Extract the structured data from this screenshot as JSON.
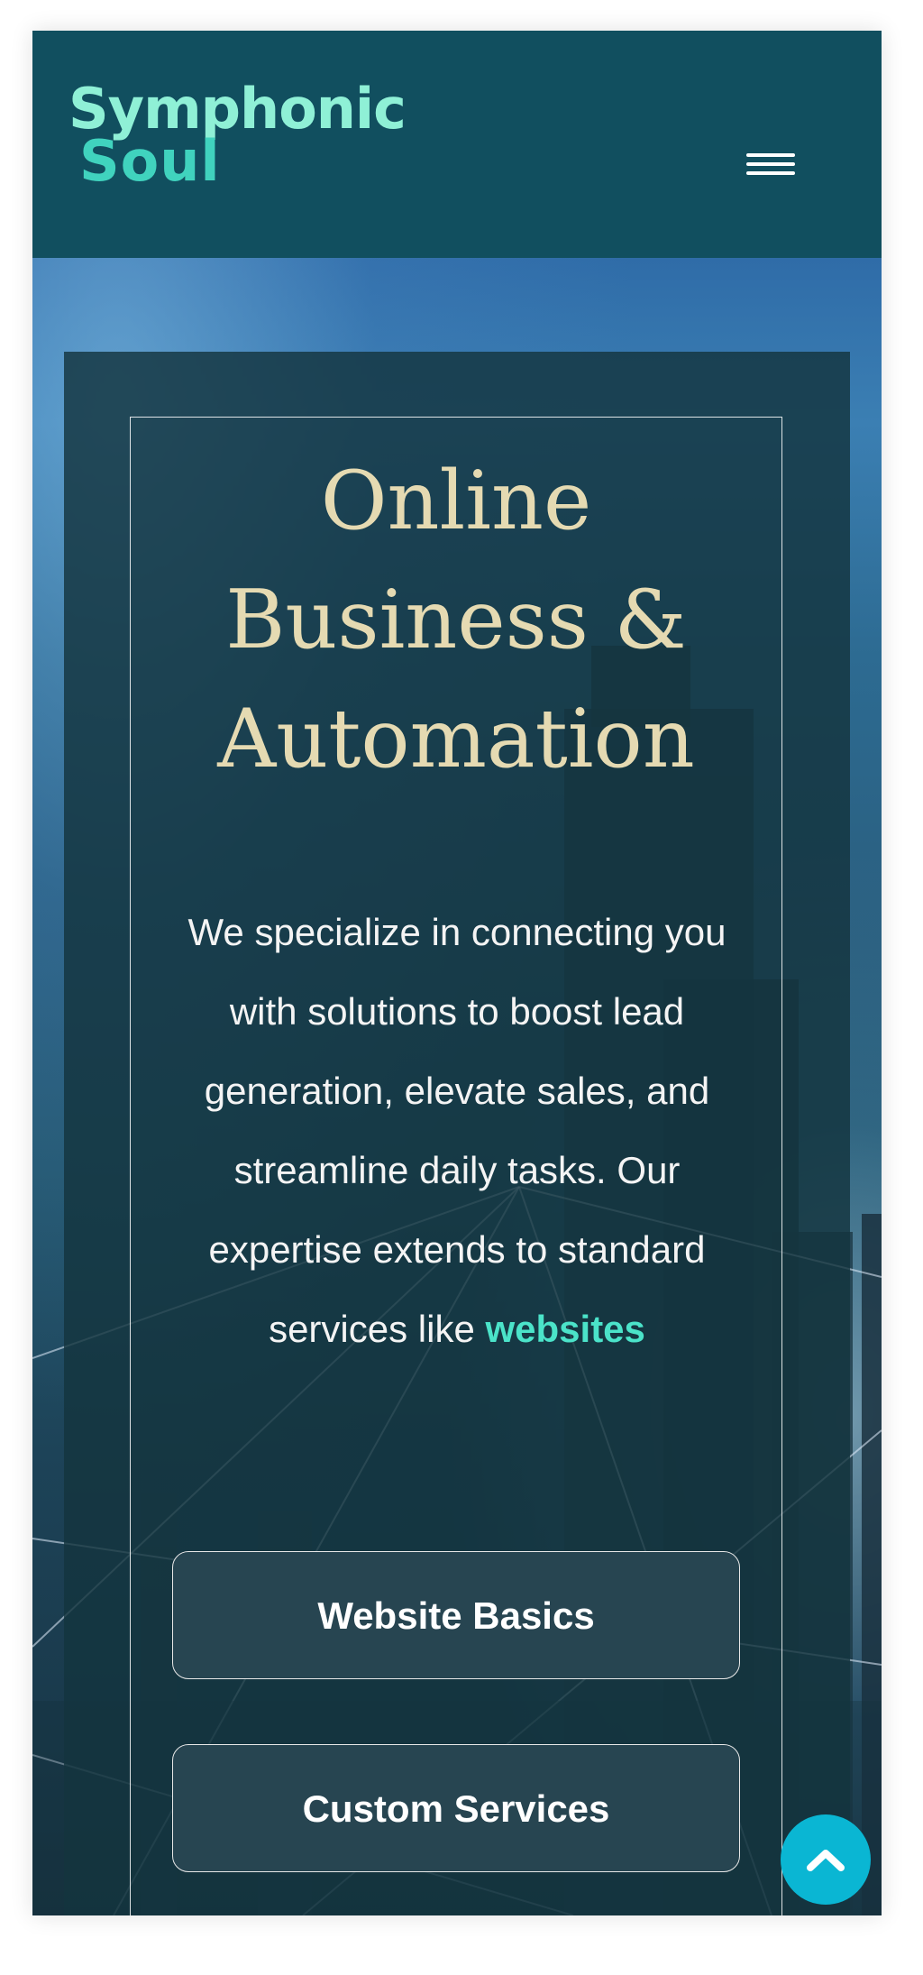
{
  "brand": {
    "line1": "Symphonic",
    "line2": "Soul"
  },
  "header": {
    "menu_icon": "hamburger-menu-icon"
  },
  "hero": {
    "title": "Online Business & Automation",
    "description_text": "We specialize in connecting you with solutions to boost lead generation, elevate sales, and streamline daily tasks. Our expertise extends to standard services like ",
    "description_link": "websites",
    "buttons": {
      "website_basics": "Website Basics",
      "custom_services": "Custom Services"
    }
  },
  "scroll_top": {
    "icon": "chevron-up-icon"
  },
  "colors": {
    "header_bg": "#114f5f",
    "logo_primary": "#8ff0d6",
    "logo_secondary": "#40d3be",
    "title": "#e5dab2",
    "link": "#4be3c9",
    "button_bg": "#274551",
    "scroll_button": "#0ab6d3"
  }
}
